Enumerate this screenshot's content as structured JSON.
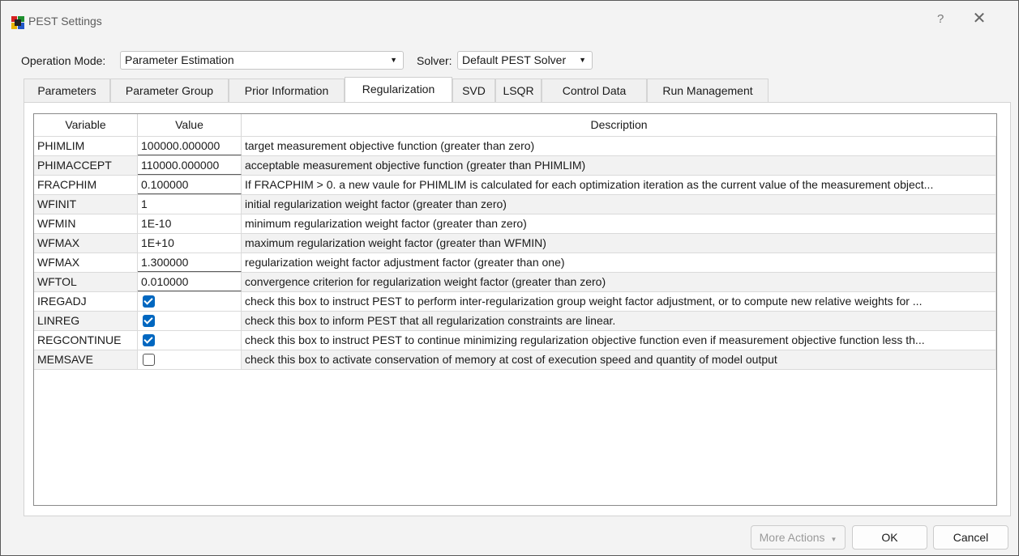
{
  "window": {
    "title": "PEST Settings",
    "help_glyph": "?",
    "close_glyph": "✕"
  },
  "top": {
    "operation_mode_label": "Operation Mode:",
    "operation_mode_value": "Parameter Estimation",
    "solver_label": "Solver:",
    "solver_value": "Default PEST Solver",
    "dropdown_arrow": "▼"
  },
  "tabs": [
    {
      "label": "Parameters"
    },
    {
      "label": "Parameter Group"
    },
    {
      "label": "Prior Information"
    },
    {
      "label": "Regularization",
      "active": true
    },
    {
      "label": "SVD"
    },
    {
      "label": "LSQR"
    },
    {
      "label": "Control Data"
    },
    {
      "label": "Run Management"
    }
  ],
  "table": {
    "headers": [
      "Variable",
      "Value",
      "Description"
    ],
    "rows": [
      {
        "variable": "PHIMLIM",
        "value": "100000.000000",
        "description": "target measurement objective function (greater than zero)"
      },
      {
        "variable": "PHIMACCEPT",
        "value": "110000.000000",
        "description": "acceptable measurement objective function  (greater than PHIMLIM)"
      },
      {
        "variable": "FRACPHIM",
        "value": "0.100000",
        "description": "If FRACPHIM > 0. a new vaule for PHIMLIM is calculated for each optimization iteration as the current value of the measurement object..."
      },
      {
        "variable": "WFINIT",
        "value": "1",
        "description": "initial regularization weight factor (greater than zero)"
      },
      {
        "variable": "WFMIN",
        "value": "1E-10",
        "description": "minimum regularization weight factor (greater than zero)"
      },
      {
        "variable": "WFMAX",
        "value": "1E+10",
        "description": "maximum regularization weight factor (greater than WFMIN)"
      },
      {
        "variable": "WFMAX",
        "value": "1.300000",
        "description": "regularization weight factor adjustment factor (greater than one)"
      },
      {
        "variable": "WFTOL",
        "value": "0.010000",
        "description": "convergence criterion for regularization weight factor (greater than zero)"
      },
      {
        "variable": "IREGADJ",
        "checked": true,
        "description": "check this box to instruct PEST to perform inter-regularization group weight factor adjustment, or to compute new relative weights for ..."
      },
      {
        "variable": "LINREG",
        "checked": true,
        "description": "check this box  to inform PEST that all regularization constraints are linear."
      },
      {
        "variable": "REGCONTINUE",
        "checked": true,
        "description": "check this box to instruct PEST to continue minimizing regularization objective function even if measurement objective function less th..."
      },
      {
        "variable": "MEMSAVE",
        "checked": false,
        "description": "check this box to activate conservation of memory at cost of execution speed and quantity of model output"
      }
    ]
  },
  "buttons": {
    "more_actions": "More Actions",
    "more_actions_arrow": "▼",
    "ok": "OK",
    "cancel": "Cancel"
  },
  "colors": {
    "checkbox_checked": "#0067c0",
    "alt_row": "#f2f2f2",
    "grid_border": "#8a8a8a"
  },
  "icons": {
    "app": "pest-app-icon",
    "close": "close-icon",
    "help": "help-icon",
    "checkbox": "checkbox-icon"
  }
}
